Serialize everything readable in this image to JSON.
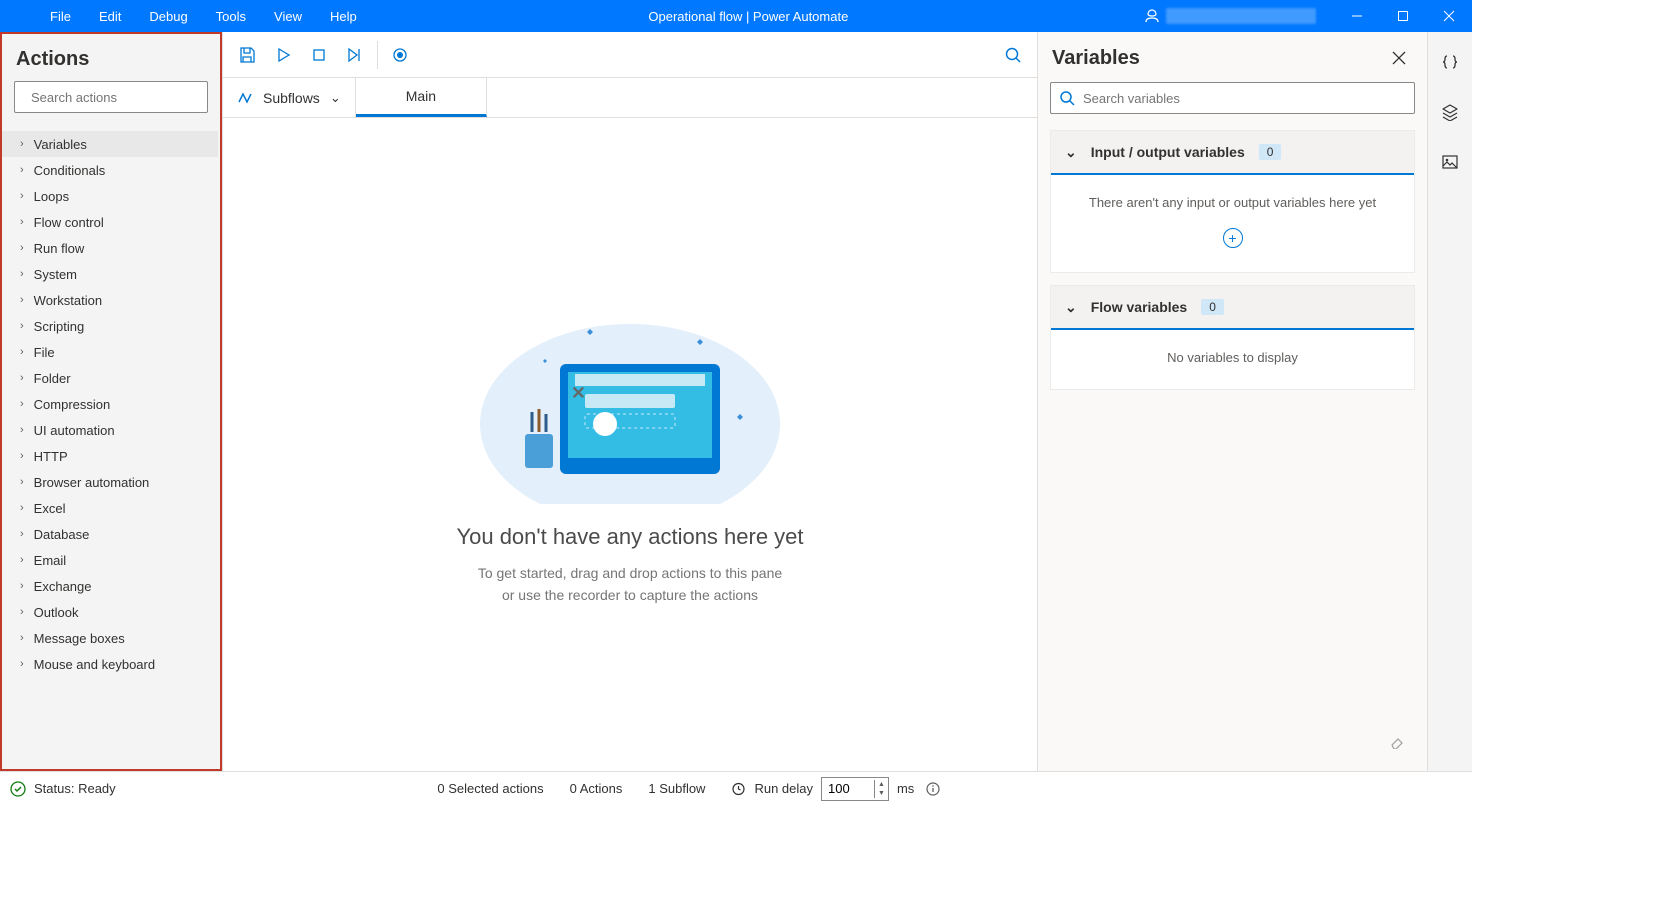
{
  "titlebar": {
    "menus": [
      "File",
      "Edit",
      "Debug",
      "Tools",
      "View",
      "Help"
    ],
    "title": "Operational flow | Power Automate"
  },
  "actions_panel": {
    "title": "Actions",
    "search_placeholder": "Search actions",
    "categories": [
      "Variables",
      "Conditionals",
      "Loops",
      "Flow control",
      "Run flow",
      "System",
      "Workstation",
      "Scripting",
      "File",
      "Folder",
      "Compression",
      "UI automation",
      "HTTP",
      "Browser automation",
      "Excel",
      "Database",
      "Email",
      "Exchange",
      "Outlook",
      "Message boxes",
      "Mouse and keyboard"
    ]
  },
  "tabs": {
    "subflows_label": "Subflows",
    "main_tab": "Main"
  },
  "canvas": {
    "heading": "You don't have any actions here yet",
    "sub1": "To get started, drag and drop actions to this pane",
    "sub2": "or use the recorder to capture the actions"
  },
  "vars_panel": {
    "title": "Variables",
    "search_placeholder": "Search variables",
    "io_section": {
      "label": "Input / output variables",
      "count": "0",
      "empty": "There aren't any input or output variables here yet"
    },
    "flow_section": {
      "label": "Flow variables",
      "count": "0",
      "empty": "No variables to display"
    }
  },
  "statusbar": {
    "status": "Status: Ready",
    "selected": "0 Selected actions",
    "actions": "0 Actions",
    "subflows": "1 Subflow",
    "run_delay": "Run delay",
    "delay_value": "100",
    "ms": "ms"
  }
}
